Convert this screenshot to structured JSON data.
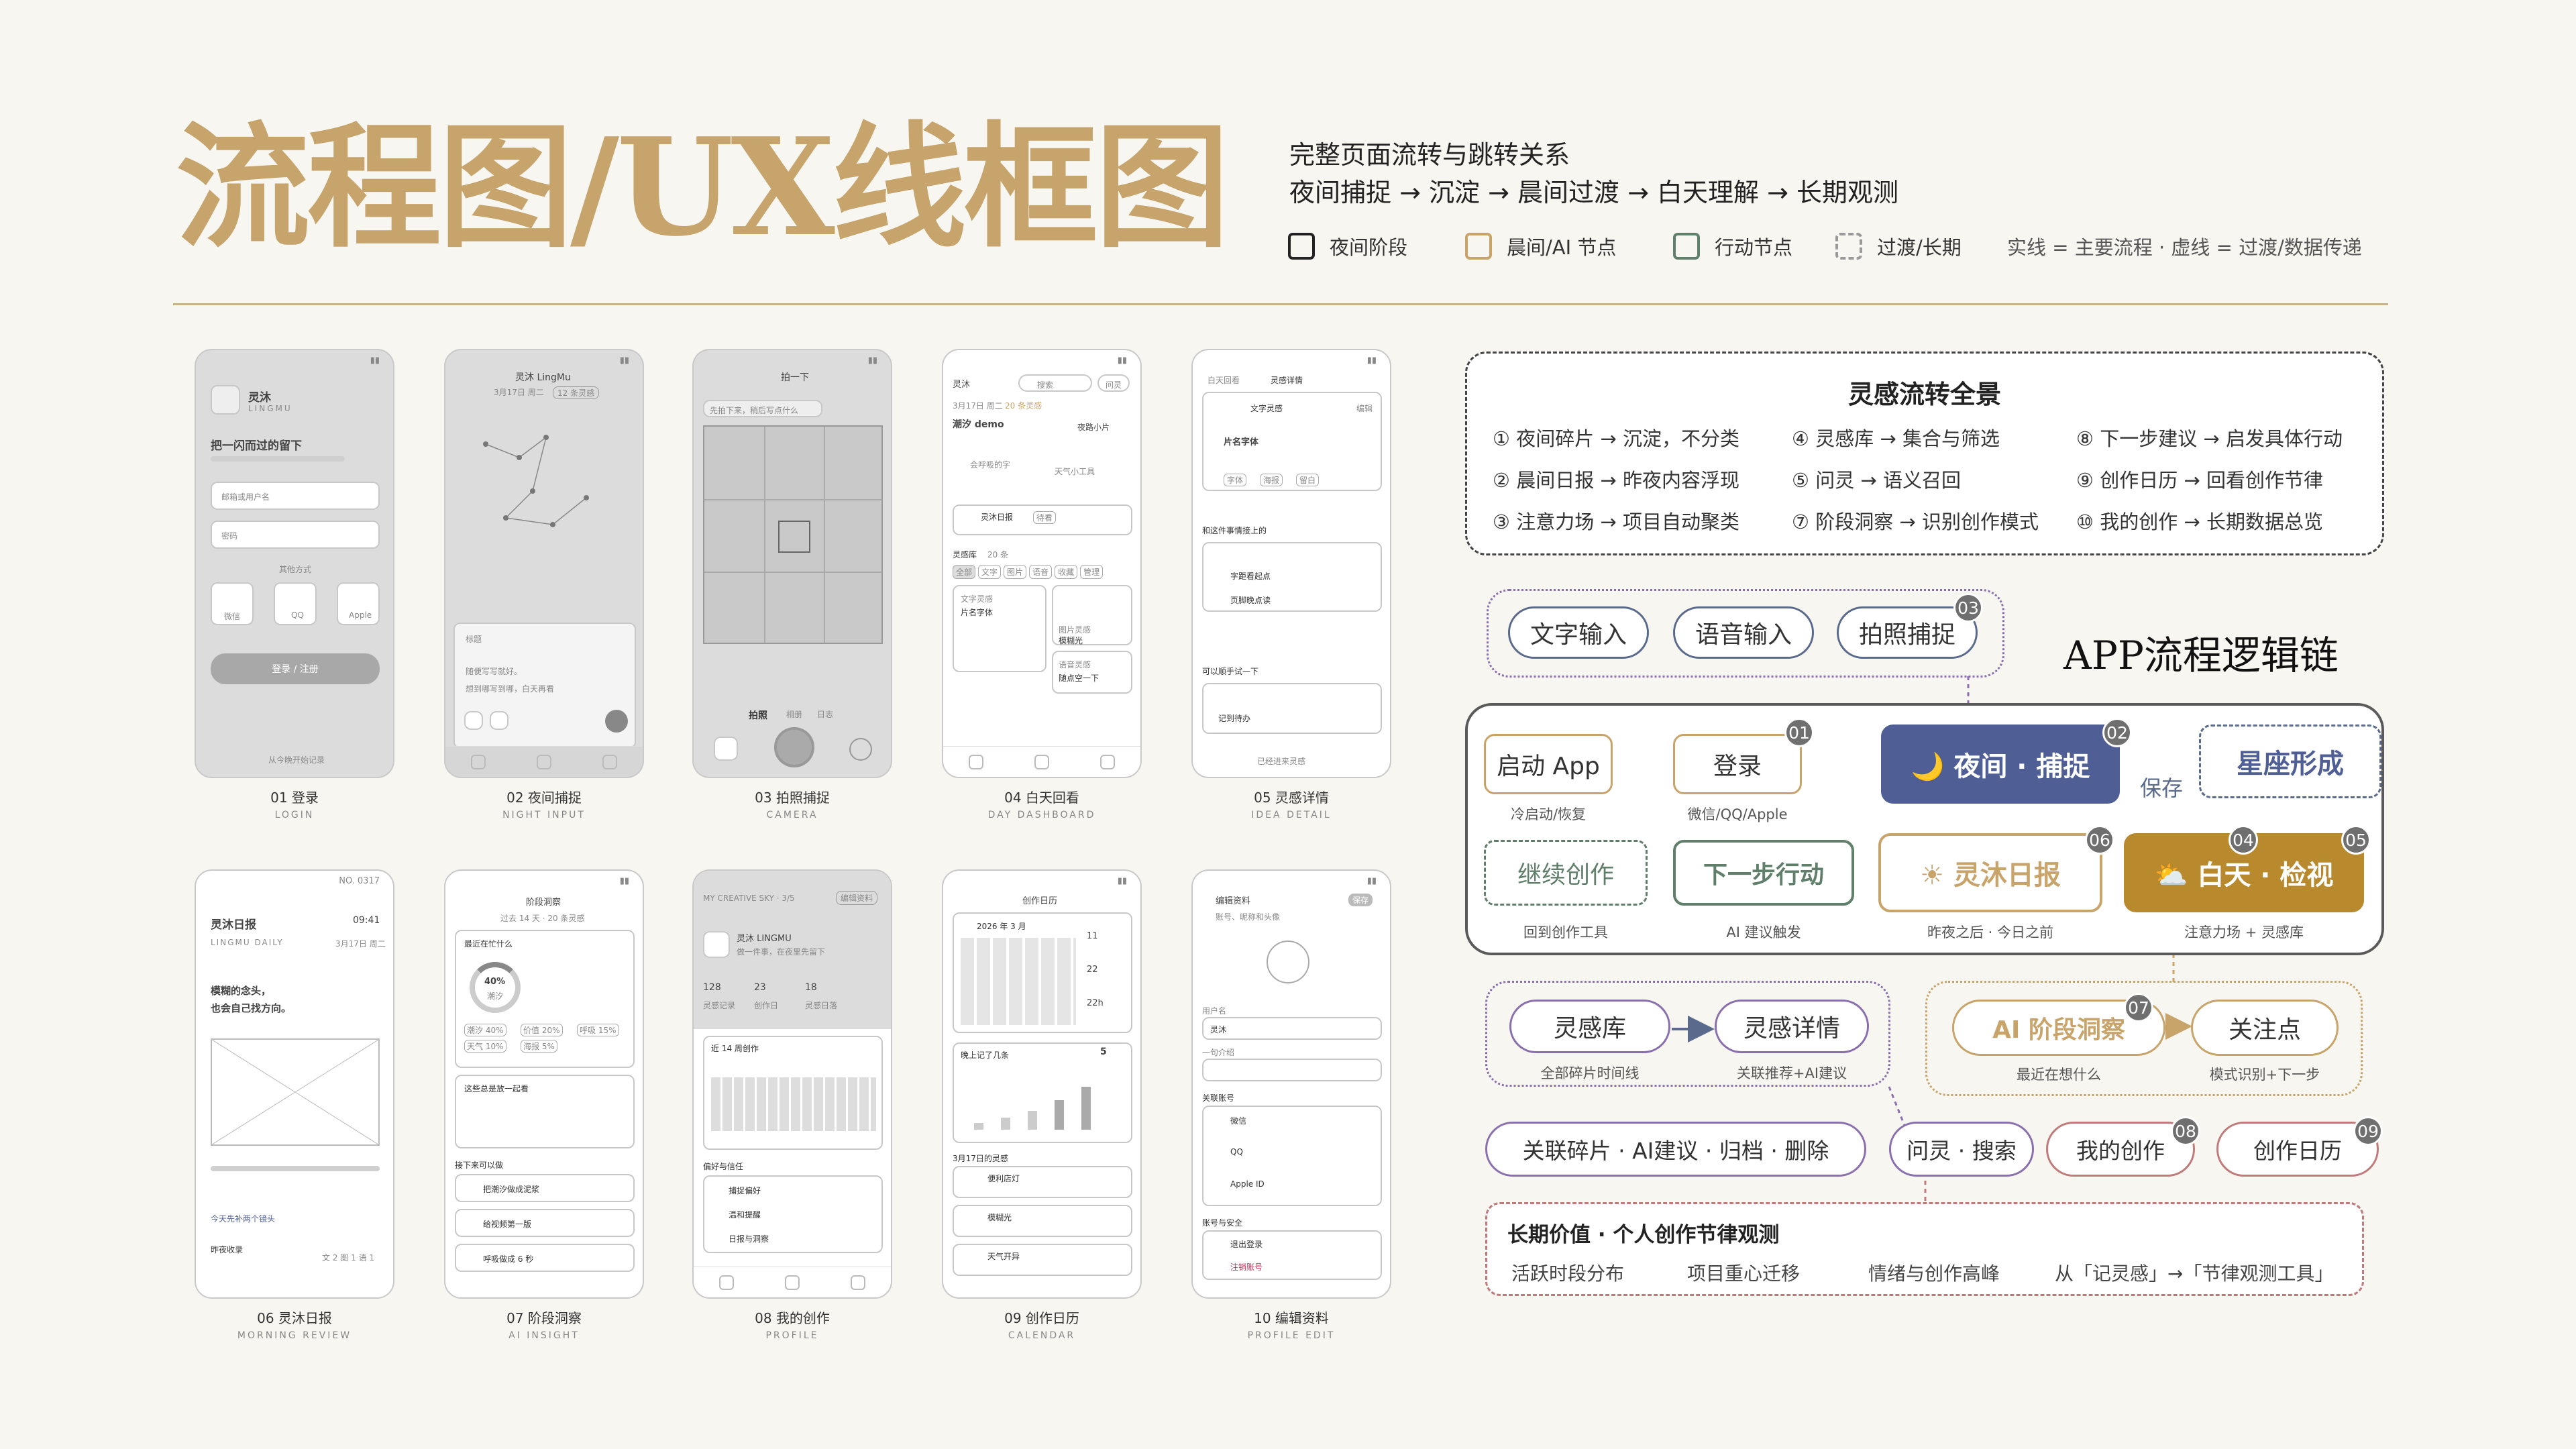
{
  "header": {
    "title": "流程图/UX线框图",
    "subtitle_line1": "完整页面流转与跳转关系",
    "subtitle_line2": "夜间捕捉 → 沉淀 → 晨间过渡 → 白天理解 → 长期观测"
  },
  "legend": {
    "items": [
      {
        "label": "夜间阶段",
        "color": "#222222",
        "style": "solid"
      },
      {
        "label": "晨间/AI 节点",
        "color": "#c8a46a",
        "style": "solid"
      },
      {
        "label": "行动节点",
        "color": "#5f7f6a",
        "style": "solid"
      },
      {
        "label": "过渡/长期",
        "color": "#999999",
        "style": "dashed"
      }
    ],
    "note": "实线 = 主要流程 · 虚线 = 过渡/数据传递"
  },
  "screens": [
    {
      "caption": "01 登录",
      "en": "LOGIN"
    },
    {
      "caption": "02 夜间捕捉",
      "en": "NIGHT INPUT"
    },
    {
      "caption": "03 拍照捕捉",
      "en": "CAMERA"
    },
    {
      "caption": "04 白天回看",
      "en": "DAY DASHBOARD"
    },
    {
      "caption": "05 灵感详情",
      "en": "IDEA DETAIL"
    },
    {
      "caption": "06 灵沐日报",
      "en": "MORNING REVIEW"
    },
    {
      "caption": "07 阶段洞察",
      "en": "AI INSIGHT"
    },
    {
      "caption": "08 我的创作",
      "en": "PROFILE"
    },
    {
      "caption": "09 创作日历",
      "en": "CALENDAR"
    },
    {
      "caption": "10 编辑资料",
      "en": "PROFILE EDIT"
    }
  ],
  "screen_text": {
    "s1": {
      "app": "灵沐",
      "app_en": "LINGMU",
      "slogan": "把一闪而过的留下",
      "phone_ph": "邮箱或用户名",
      "pwd_ph": "密码",
      "other": "其他方式",
      "wechat": "微信",
      "qq": "QQ",
      "apple": "Apple",
      "login": "登录 / 注册",
      "footer": "从今晚开始记录"
    },
    "s2": {
      "app": "灵沐 LingMu",
      "date": "3月17日 周二",
      "count": "12 条灵感",
      "title_ph": "标题",
      "body1": "随便写写就好。",
      "body2": "想到哪写到哪，白天再看"
    },
    "s3": {
      "top": "拍一下",
      "hint": "先拍下来，稍后写点什么",
      "tab1": "拍照",
      "tab2": "相册",
      "tab3": "日志"
    },
    "s4": {
      "app": "灵沐",
      "search": "搜索",
      "btn": "问灵",
      "date": "3月17日 周二",
      "count": "20 条灵感",
      "item1": "潮汐 demo",
      "item1b": "夜路小片",
      "sub1": "会呼吸的字",
      "sub2": "天气小工具",
      "daily": "灵沐日报",
      "daily_tag": "待看",
      "lib": "灵感库",
      "lib_count": "20 条",
      "chips": [
        "全部",
        "文字",
        "图片",
        "语音",
        "收藏",
        "管理"
      ],
      "card1": "文字灵感",
      "card1b": "片名字体",
      "card2": "图片灵感",
      "card2b": "模糊光",
      "card3": "语音灵感",
      "card3b": "随点空一下"
    },
    "s5": {
      "back": "白天回看",
      "title": "灵感详情",
      "t1": "文字灵感",
      "t1b": "片名字体",
      "edit": "编辑",
      "tags": [
        "字体",
        "海报",
        "留白"
      ],
      "rel": "和这件事情接上的",
      "rel1": "字距看起点",
      "rel2": "页脚晚点读",
      "next": "可以顺手试一下",
      "next1": "记到待办",
      "done": "已经进来灵感"
    },
    "s6": {
      "no": "NO. 0317",
      "title": "灵沐日报",
      "time": "09:41",
      "en": "LINGMU DAILY",
      "date": "3月17日 周二",
      "quote1": "模糊的念头，",
      "quote2": "也会自己找方向。",
      "link": "今天先补两个镜头",
      "label": "昨夜收录",
      "stat": "文 2  图 1  语 1"
    },
    "s7": {
      "title": "阶段洞察",
      "range": "过去 14 天 · 20 条灵感",
      "q": "最近在忙什么",
      "pct": "40%",
      "pct_label": "潮汐",
      "tags": [
        "潮汐 40%",
        "价值 20%",
        "呼吸 15%",
        "天气 10%",
        "海报 5%"
      ],
      "together": "这些总是放一起看",
      "next": "接下来可以做",
      "acts": [
        "把潮汐做成泥浆",
        "给视频第一版",
        "呼吸做成 6 秒"
      ]
    },
    "s8": {
      "top": "MY CREATIVE SKY · 3/5",
      "edit": "编辑资料",
      "name": "灵沐 LINGMU",
      "sub": "做一件事，在夜里先留下",
      "n1": "128",
      "n2": "23",
      "n3": "18",
      "l1": "灵感记录",
      "l2": "创作日",
      "l3": "灵感日落",
      "recent": "近 14 周创作",
      "pref": "偏好与信任",
      "p1": "捕捉偏好",
      "p2": "温和提醒",
      "p3": "日报与洞察"
    },
    "s9": {
      "title": "创作日历",
      "month": "2026 年 3 月",
      "d1": "11",
      "d2": "22",
      "d3": "22h",
      "night": "晚上记了几条",
      "night_n": "5",
      "today": "3月17日的灵感",
      "e1": "便利店灯",
      "e2": "模糊光",
      "e3": "天气开异"
    },
    "s10": {
      "title": "编辑资料",
      "save": "保存",
      "hint": "账号、昵称和头像",
      "name_label": "用户名",
      "name": "灵沐",
      "bio": "一句介绍",
      "bind": "关联账号",
      "b1": "微信",
      "b2": "QQ",
      "b3": "Apple ID",
      "safe": "账号与安全",
      "logout": "退出登录",
      "del": "注销账号"
    }
  },
  "overview": {
    "title": "灵感流转全景",
    "items": [
      "① 夜间碎片 → 沉淀，不分类",
      "④ 灵感库 → 集合与筛选",
      "⑧ 下一步建议 → 启发具体行动",
      "② 晨间日报 → 昨夜内容浮现",
      "⑤ 问灵 → 语义召回",
      "⑨ 创作日历 → 回看创作节律",
      "③ 注意力场 → 项目自动聚类",
      "⑦ 阶段洞察 → 识别创作模式",
      "⑩ 我的创作 → 长期数据总览"
    ]
  },
  "flow": {
    "chain_title": "APP流程逻辑链",
    "inputs": [
      "文字输入",
      "语音输入",
      "拍照捕捉"
    ],
    "input_badge": "03",
    "start": "启动 App",
    "start_cap": "冷启动/恢复",
    "login": "登录",
    "login_cap": "微信/QQ/Apple",
    "login_badge": "01",
    "night": "🌙 夜间 · 捕捉",
    "night_badge": "02",
    "save": "保存",
    "const": "星座形成",
    "day": "⛅ 白天 · 检视",
    "day_badge1": "04",
    "day_badge2": "05",
    "day_cap": "注意力场 + 灵感库",
    "daily": "☀ 灵沐日报",
    "daily_badge": "06",
    "daily_cap": "昨夜之后 · 今日之前",
    "next": "下一步行动",
    "next_cap": "AI 建议触发",
    "continue": "继续创作",
    "continue_cap": "回到创作工具",
    "lib": "灵感库",
    "lib_cap": "全部碎片时间线",
    "detail": "灵感详情",
    "detail_cap": "关联推荐+AI建议",
    "insight": "AI 阶段洞察",
    "insight_badge": "07",
    "insight_cap": "最近在想什么",
    "focus": "关注点",
    "focus_cap": "模式识别+下一步",
    "ops": "关联碎片 · AI建议 · 归档 · 删除",
    "ask": "问灵 · 搜索",
    "mine": "我的创作",
    "mine_badge": "08",
    "cal": "创作日历",
    "cal_badge": "09"
  },
  "long": {
    "title": "长期价值 · 个人创作节律观测",
    "items": [
      "活跃时段分布",
      "项目重心迁移",
      "情绪与创作高峰",
      "从「记灵感」→「节律观测工具」"
    ]
  },
  "colors": {
    "gold": "#c8a46a",
    "navy": "#4f5f96",
    "brown": "#b9892e",
    "green": "#5f7f6a",
    "purple": "#8a6fae",
    "red": "#c07a7a"
  }
}
